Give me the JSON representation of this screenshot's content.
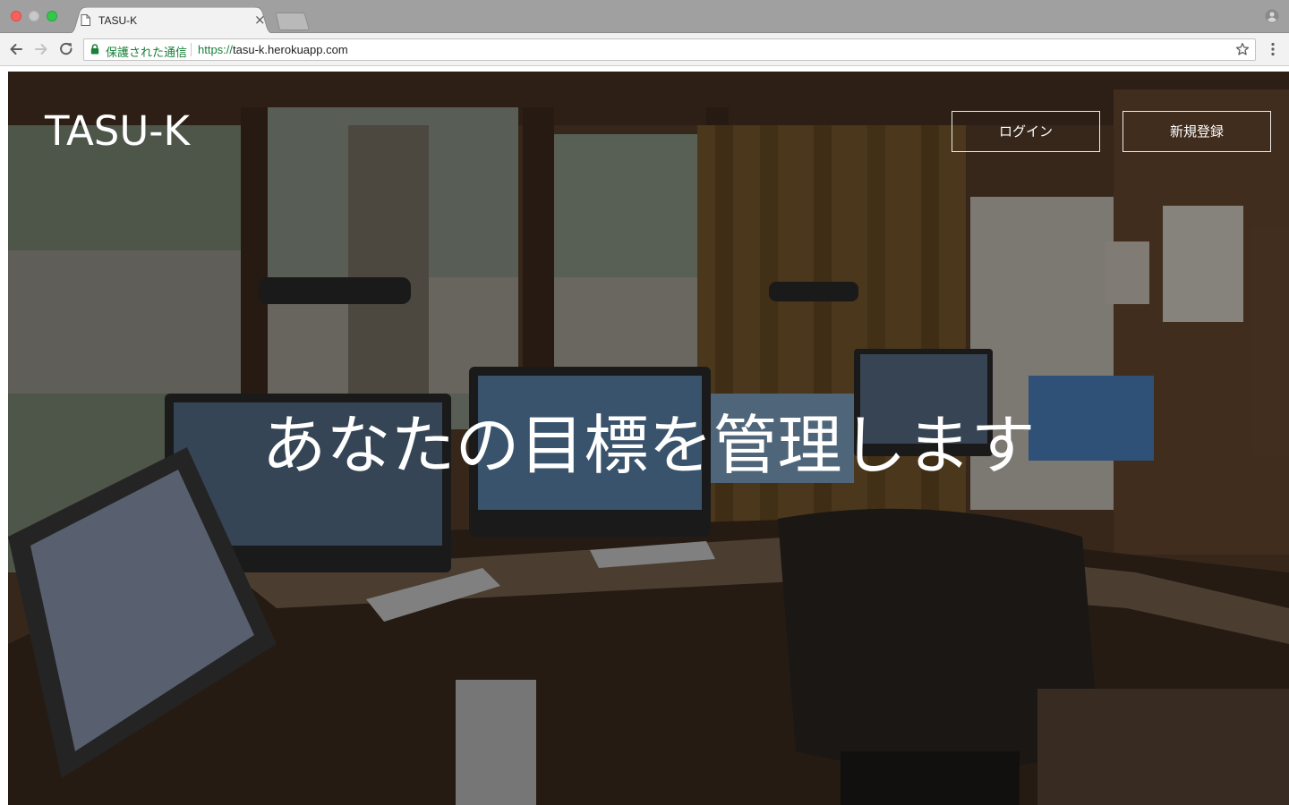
{
  "browser": {
    "tab": {
      "title": "TASU-K",
      "close_glyph": "×"
    },
    "omnibox": {
      "secure_label": "保護された通信",
      "url_scheme": "https://",
      "url_host": "tasu-k.herokuapp.com"
    },
    "icons": [
      "page-icon",
      "close-icon",
      "new-tab-icon",
      "profile-icon",
      "back-arrow-icon",
      "forward-arrow-icon",
      "reload-icon",
      "lock-icon",
      "star-icon",
      "kebab-menu-icon"
    ],
    "colors": {
      "tab_strip": "#a0a0a0",
      "toolbar": "#f2f2f2",
      "secure_green": "#188038"
    }
  },
  "page": {
    "brand": "TASU-K",
    "nav": {
      "login_label": "ログイン",
      "signup_label": "新規登録"
    },
    "hero": {
      "headline": "あなたの目標を管理します",
      "background": "dimmed photo of a home office with multiple computer monitors"
    },
    "colors": {
      "text": "#ffffff",
      "overlay": "rgba(0,0,0,0.38)"
    }
  }
}
